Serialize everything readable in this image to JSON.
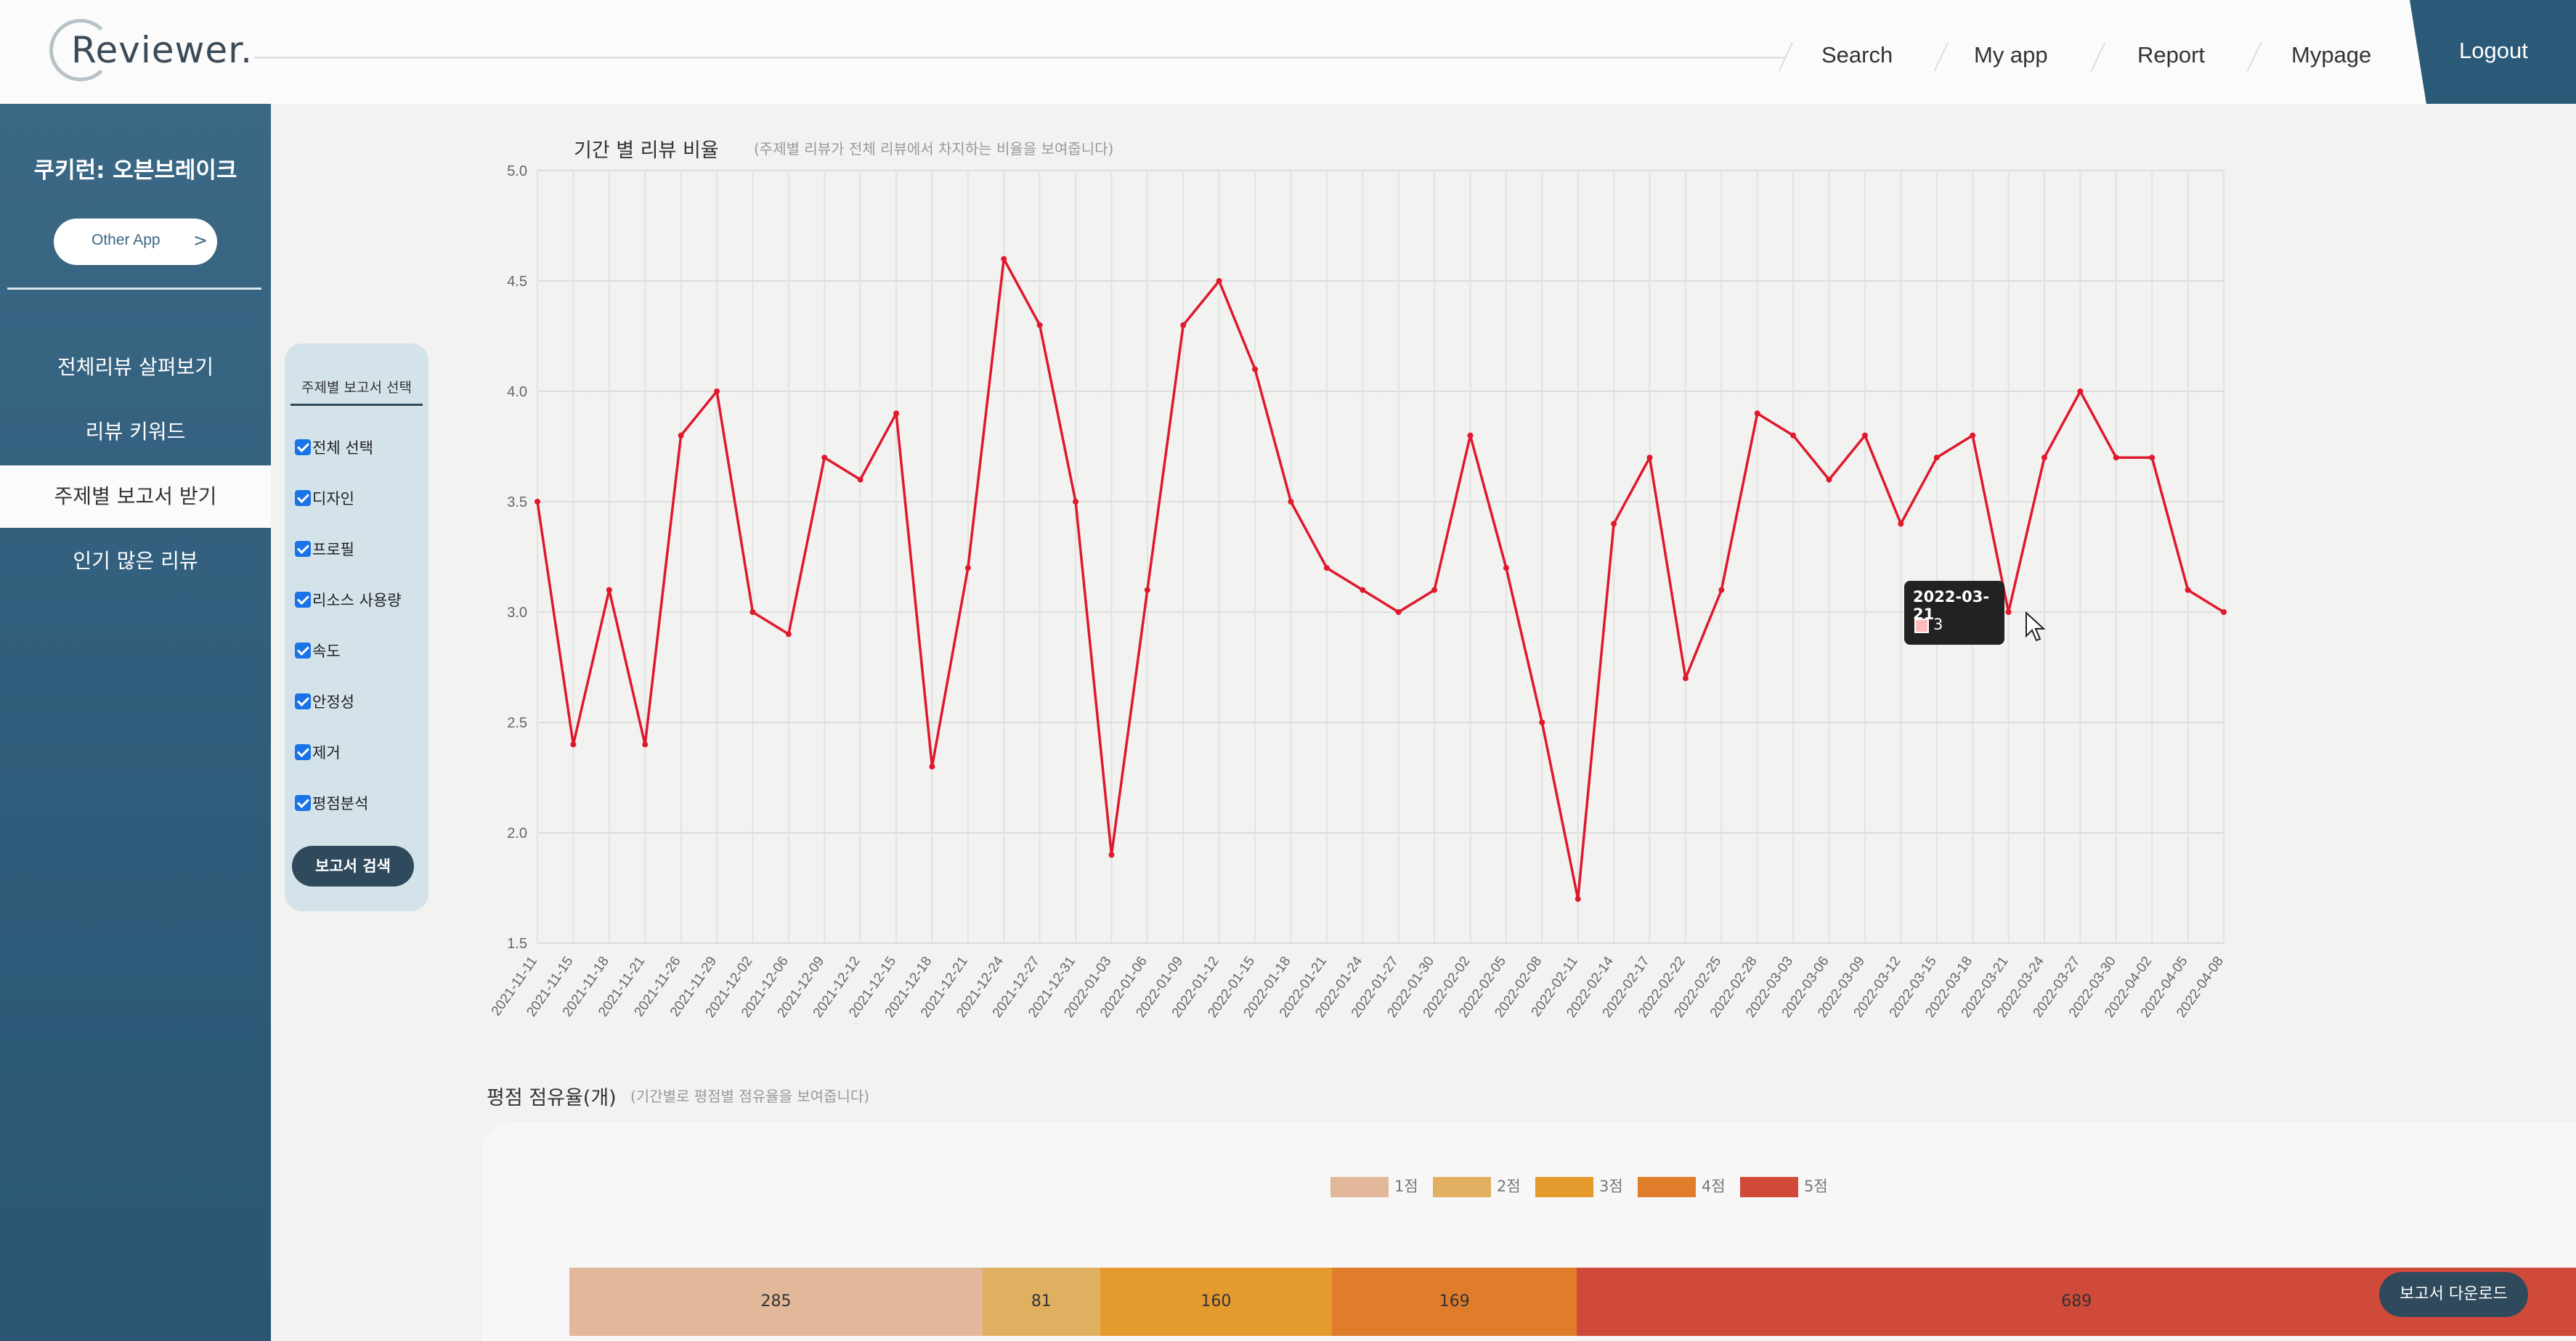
{
  "header": {
    "logo": "Reviewer.",
    "nav": [
      "Search",
      "My app",
      "Report",
      "Mypage"
    ],
    "logout": "Logout"
  },
  "sidebar": {
    "app_name": "쿠키런: 오븐브레이크",
    "other_app": "Other App",
    "other_app_chevron": ">",
    "items": [
      {
        "label": "전체리뷰 살펴보기",
        "active": false
      },
      {
        "label": "리뷰 키워드",
        "active": false
      },
      {
        "label": "주제별 보고서 받기",
        "active": true
      },
      {
        "label": "인기 많은 리뷰",
        "active": false
      }
    ]
  },
  "filter_panel": {
    "title": "주제별 보고서 선택",
    "options": [
      {
        "label": "전체 선택",
        "checked": true
      },
      {
        "label": "디자인",
        "checked": true
      },
      {
        "label": "프로필",
        "checked": true
      },
      {
        "label": "리소스 사용량",
        "checked": true
      },
      {
        "label": "속도",
        "checked": true
      },
      {
        "label": "안정성",
        "checked": true
      },
      {
        "label": "제거",
        "checked": true
      },
      {
        "label": "평점분석",
        "checked": true
      }
    ],
    "search_button": "보고서 검색"
  },
  "line_chart": {
    "title": "기간 별 리뷰 비율",
    "subtitle": "(주제별 리뷰가 전체 리뷰에서 차지하는 비율을 보여줍니다)",
    "tooltip": {
      "date": "2022-03-21",
      "value": "3"
    }
  },
  "chart_data": [
    {
      "type": "line",
      "title": "기간 별 리뷰 비율",
      "ylim": [
        1.5,
        5.0
      ],
      "yticks": [
        "5.0",
        "4.5",
        "4.0",
        "3.5",
        "3.0",
        "2.5",
        "2.0",
        "1.5"
      ],
      "grid": true,
      "color": "#e0182c",
      "x": [
        "2021-11-11",
        "2021-11-15",
        "2021-11-18",
        "2021-11-21",
        "2021-11-26",
        "2021-11-29",
        "2021-12-02",
        "2021-12-06",
        "2021-12-09",
        "2021-12-12",
        "2021-12-15",
        "2021-12-18",
        "2021-12-21",
        "2021-12-24",
        "2021-12-27",
        "2021-12-31",
        "2022-01-03",
        "2022-01-06",
        "2022-01-09",
        "2022-01-12",
        "2022-01-15",
        "2022-01-18",
        "2022-01-21",
        "2022-01-24",
        "2022-01-27",
        "2022-01-30",
        "2022-02-02",
        "2022-02-05",
        "2022-02-08",
        "2022-02-11",
        "2022-02-14",
        "2022-02-17",
        "2022-02-22",
        "2022-02-25",
        "2022-02-28",
        "2022-03-03",
        "2022-03-06",
        "2022-03-09",
        "2022-03-12",
        "2022-03-15",
        "2022-03-18",
        "2022-03-21",
        "2022-03-24",
        "2022-03-27",
        "2022-03-30",
        "2022-04-02",
        "2022-04-05",
        "2022-04-08"
      ],
      "values": [
        3.5,
        2.4,
        3.1,
        2.4,
        3.8,
        4.0,
        3.0,
        2.9,
        3.7,
        3.6,
        3.9,
        2.3,
        3.2,
        4.6,
        4.3,
        3.5,
        1.9,
        3.1,
        4.3,
        4.5,
        4.1,
        3.5,
        3.2,
        3.1,
        3.0,
        3.1,
        3.8,
        3.2,
        2.5,
        1.7,
        3.4,
        3.7,
        2.7,
        3.1,
        3.9,
        3.8,
        3.6,
        3.8,
        3.4,
        3.7,
        3.8,
        3.0,
        3.7,
        4.0,
        3.7,
        3.7,
        3.1,
        3.0
      ]
    },
    {
      "type": "bar",
      "title": "평점 점유율(개)",
      "subtitle": "(기간별로 평점별 점유율을 보여줍니다)",
      "orientation": "horizontal-stacked",
      "categories": [
        "1점",
        "2점",
        "3점",
        "4점",
        "5점"
      ],
      "values": [
        285,
        81,
        160,
        169,
        689
      ],
      "colors": [
        "#e3b89a",
        "#e0b060",
        "#e59a2e",
        "#e07d2a",
        "#d04a3a"
      ]
    }
  ],
  "download_button": "보고서 다운로드"
}
